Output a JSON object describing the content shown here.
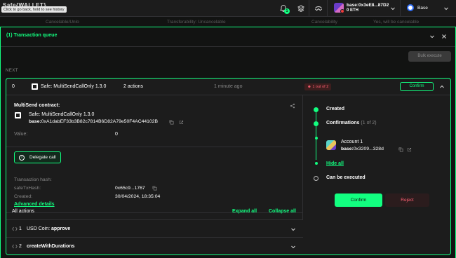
{
  "topbar": {
    "logo_text": "Safe{WALLET}",
    "tooltip": "Click to go back, hold to see history",
    "notification_count": "1",
    "account_address": "base:0x3eE8...87D2",
    "account_balance": "0 ETH",
    "network_label": "Base"
  },
  "background_row": {
    "col1": "Cancelable/Unlo",
    "col2": "Transferability: Uncancelable",
    "col3": "Cancelability",
    "col4": "Yes, will be cancelable"
  },
  "queue": {
    "title": "(1) Transaction queue",
    "bulk_execute_label": "Bulk execute",
    "next_label": "NEXT"
  },
  "transaction": {
    "nonce": "0",
    "type": "Safe: MultiSendCallOnly 1.3.0",
    "action_count": "2 actions",
    "time": "1 minute ago",
    "status": "1 out of 2",
    "confirm_label": "Confirm"
  },
  "details": {
    "multisend_label": "MultiSend contract:",
    "contract_name": "Safe: MultiSendCallOnly 1.3.0",
    "contract_prefix": "base:",
    "contract_address": "0xA1dabEF33b3B82c7814B6D82A79e50F4AC44102B",
    "value_label": "Value:",
    "value": "0",
    "delegate_label": "Delegate call",
    "tx_hash_label": "Transaction hash:",
    "safe_tx_hash_label": "safeTxHash:",
    "safe_tx_hash": "0x65c9...1767",
    "created_label": "Created:",
    "created": "30/04/2024, 18:35:04",
    "advanced_label": "Advanced details"
  },
  "signers": {
    "created_label": "Created",
    "confirmations_label": "Confirmations",
    "confirmations_count": "(1 of 2)",
    "owner_name": "Account 1",
    "owner_prefix": "base:",
    "owner_address": "0x3209...328d",
    "hide_all_label": "Hide all",
    "executable_label": "Can be executed",
    "confirm_button": "Confirm",
    "reject_button": "Reject"
  },
  "actions": {
    "all_actions_label": "All actions",
    "expand_all_label": "Expand all",
    "collapse_all_label": "Collapse all",
    "items": [
      {
        "index": "1",
        "token": "USD Coin:",
        "method": "approve"
      },
      {
        "index": "2",
        "token": "",
        "method": "createWithDurations"
      }
    ]
  },
  "colors": {
    "accent": "#12ff80",
    "background": "#121312",
    "panel": "#1c1c1c",
    "error": "#ff5f72"
  }
}
